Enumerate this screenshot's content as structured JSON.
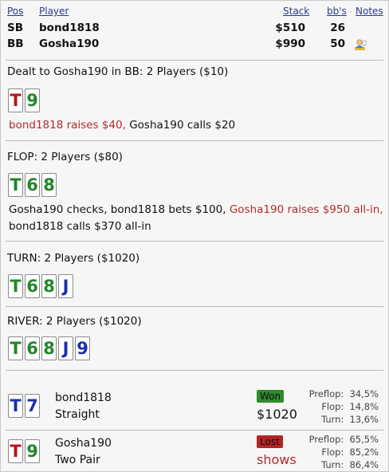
{
  "header": {
    "col_pos": "Pos",
    "col_player": "Player",
    "col_stack": "Stack",
    "col_bbs": "bb's",
    "col_notes": "Notes",
    "rows": [
      {
        "pos": "SB",
        "name": "bond1818",
        "stack": "$510",
        "bbs": "26"
      },
      {
        "pos": "BB",
        "name": "Gosha190",
        "stack": "$990",
        "bbs": "50",
        "note_icon": "user-note-icon"
      }
    ]
  },
  "preflop": {
    "title": "Dealt to Gosha190 in BB: 2 Players ($10)",
    "cards": [
      {
        "rank": "T",
        "color": "red"
      },
      {
        "rank": "9",
        "color": "green"
      }
    ],
    "action_raise": "bond1818 raises $40,",
    "action_rest": " Gosha190 calls $20"
  },
  "flop": {
    "title": "FLOP: 2 Players ($80)",
    "cards": [
      {
        "rank": "T",
        "color": "green"
      },
      {
        "rank": "6",
        "color": "green"
      },
      {
        "rank": "8",
        "color": "green"
      }
    ],
    "action_pre": "Gosha190 checks, bond1818 bets $100, ",
    "action_raise": "Gosha190 raises $950 all-in,",
    "action_post": "bond1818 calls $370 all-in"
  },
  "turn": {
    "title": "TURN: 2 Players ($1020)",
    "cards": [
      {
        "rank": "T",
        "color": "green"
      },
      {
        "rank": "6",
        "color": "green"
      },
      {
        "rank": "8",
        "color": "green"
      },
      {
        "rank": "J",
        "color": "blue"
      }
    ]
  },
  "river": {
    "title": "RIVER: 2 Players ($1020)",
    "cards": [
      {
        "rank": "T",
        "color": "green"
      },
      {
        "rank": "6",
        "color": "green"
      },
      {
        "rank": "8",
        "color": "green"
      },
      {
        "rank": "J",
        "color": "blue"
      },
      {
        "rank": "9",
        "color": "blue"
      }
    ]
  },
  "results": [
    {
      "cards": [
        {
          "rank": "T",
          "color": "blue"
        },
        {
          "rank": "7",
          "color": "blue"
        }
      ],
      "name": "bond1818",
      "hand": "Straight",
      "badge": "Won",
      "amount": "$1020",
      "equity": [
        {
          "label": "Preflop:",
          "value": "34,5%"
        },
        {
          "label": "Flop:",
          "value": "14,8%"
        },
        {
          "label": "Turn:",
          "value": "13,6%"
        }
      ]
    },
    {
      "cards": [
        {
          "rank": "T",
          "color": "red"
        },
        {
          "rank": "9",
          "color": "green"
        }
      ],
      "name": "Gosha190",
      "hand": "Two Pair",
      "badge": "Lost",
      "amount": "shows",
      "equity": [
        {
          "label": "Preflop:",
          "value": "65,5%"
        },
        {
          "label": "Flop:",
          "value": "85,2%"
        },
        {
          "label": "Turn:",
          "value": "86,4%"
        }
      ]
    }
  ],
  "colors": {
    "red_suit": "#b5161b",
    "green_suit": "#23862b",
    "blue_suit": "#1a2fb0",
    "won": "#2f8b2a",
    "lost": "#b42424"
  }
}
